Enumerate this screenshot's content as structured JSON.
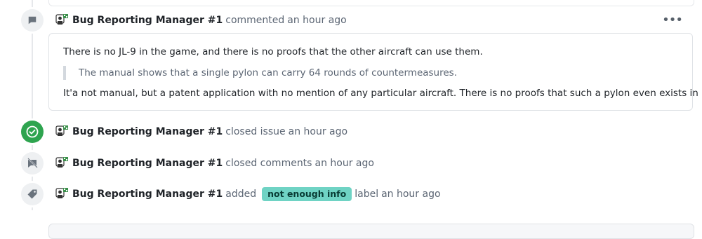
{
  "timeline": {
    "comment": {
      "author": "Bug Reporting Manager #1",
      "action": "commented",
      "time": "an hour ago",
      "more_label": "•••",
      "body": {
        "para1": "There is no JL-9 in the game, and there is no proofs that the other aircraft can use them.",
        "quote": "The manual shows that a single pylon can carry 64 rounds of countermeasures.",
        "para2": "It'a not manual, but a patent application with no mention of any particular aircraft. There is no proofs that such a pylon even exists in reality."
      }
    },
    "events": [
      {
        "author": "Bug Reporting Manager #1",
        "action": "closed issue",
        "time": "an hour ago",
        "icon": "check-circle-icon"
      },
      {
        "author": "Bug Reporting Manager #1",
        "action": "closed comments",
        "time": "an hour ago",
        "icon": "comment-locked-icon"
      },
      {
        "author": "Bug Reporting Manager #1",
        "action": "added",
        "label": "not enough info",
        "suffix": "label",
        "time": "an hour ago",
        "icon": "tag-icon"
      }
    ]
  },
  "colors": {
    "green": "#2ea44f",
    "label_bg": "#6fd3c4",
    "muted": "#5b6573"
  }
}
